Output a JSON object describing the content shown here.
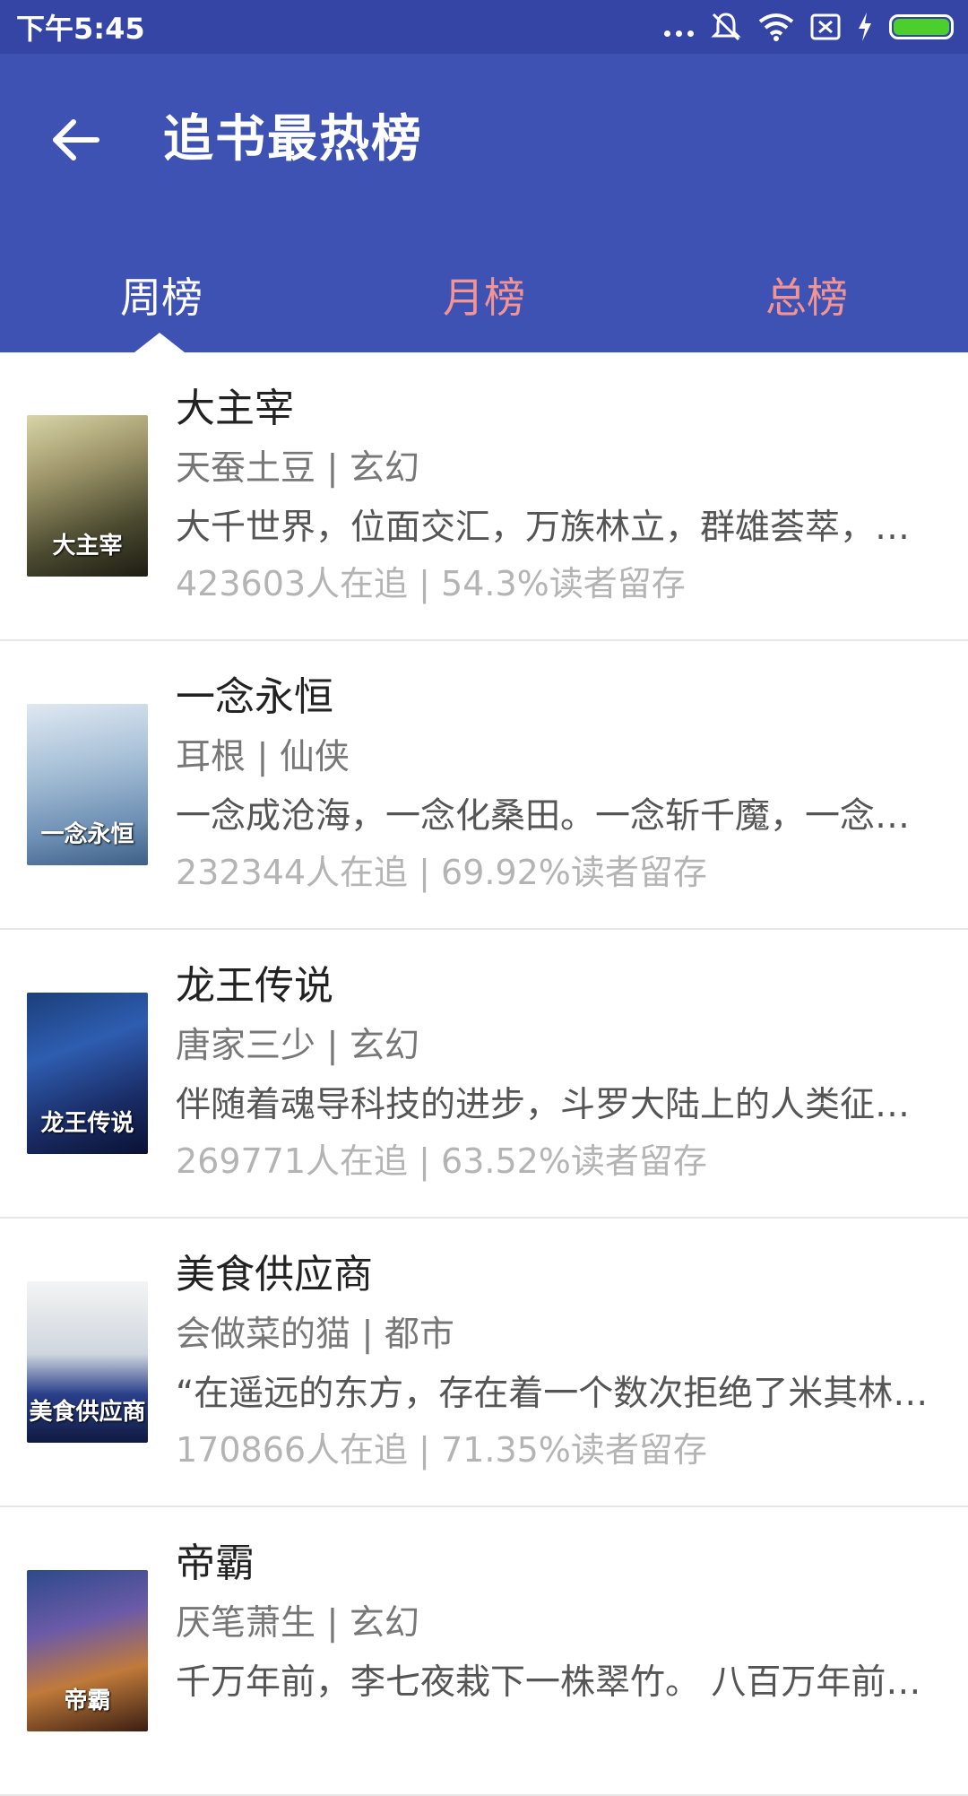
{
  "status_bar": {
    "time": "下午5:45",
    "icons": [
      "more-dots-icon",
      "silent-icon",
      "wifi-icon",
      "sim-off-icon",
      "charging-icon",
      "battery-icon"
    ],
    "battery_color": "#4ccf2c"
  },
  "app_bar": {
    "back_icon": "arrow-left-icon",
    "title": "追书最热榜",
    "background": "#3e52b4"
  },
  "tabs": [
    {
      "label": "周榜",
      "active": true
    },
    {
      "label": "月榜",
      "active": false
    },
    {
      "label": "总榜",
      "active": false
    }
  ],
  "colors": {
    "tab_active": "#ffffff",
    "tab_inactive": "#f29494",
    "status_bar_bg": "#3445a5"
  },
  "books": [
    {
      "title": "大主宰",
      "meta": "天蚕土豆 | 玄幻",
      "desc": "大千世界，位面交汇，万族林立，群雄荟萃，一位位来自下位面的天之至尊，在这无尽世界，演绎着令人向往的传奇",
      "stats": "423603人在追 |  54.3%读者留存",
      "cover_text": "大主宰"
    },
    {
      "title": "一念永恒",
      "meta": "耳根 | 仙侠",
      "desc": "一念成沧海，一念化桑田。一念斩千魔，一念诛万仙",
      "stats": "232344人在追 |  69.92%读者留存",
      "cover_text": "一念永恒"
    },
    {
      "title": "龙王传说",
      "meta": "唐家三少 | 玄幻",
      "desc": "伴随着魂导科技的进步，斗罗大陆上的人类征服了海洋",
      "stats": "269771人在追 |  63.52%读者留存",
      "cover_text": "龙王传说"
    },
    {
      "title": "美食供应商",
      "meta": "会做菜的猫 | 都市",
      "desc": "“在遥远的东方，存在着一个数次拒绝了米其林三星评定的神秘餐厅",
      "stats": "170866人在追 |  71.35%读者留存",
      "cover_text": "美食供应商"
    },
    {
      "title": "帝霸",
      "meta": "厌笔萧生 | 玄幻",
      "desc": "千万年前，李七夜栽下一株翠竹。 八百万年前，李七夜养了一条鲤鱼",
      "stats": "",
      "cover_text": "帝霸"
    }
  ]
}
